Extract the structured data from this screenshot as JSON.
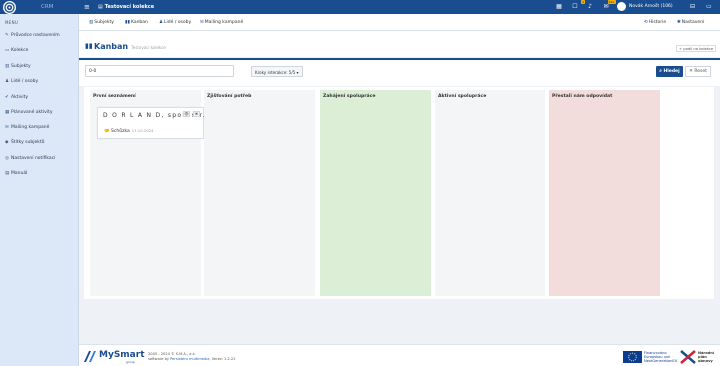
{
  "app": {
    "name": "CRM"
  },
  "topbar": {
    "title": "Testovací kolekce",
    "notify_badges": [
      "4",
      "99+"
    ],
    "user_name": "Novák Arnošt (106)"
  },
  "sidebar": {
    "heading": "MENU",
    "items": [
      {
        "label": "Průvodce nastavením",
        "icon": "wand-icon"
      },
      {
        "label": "Kolekce",
        "icon": "folder-icon"
      },
      {
        "label": "Subjekty",
        "icon": "building-icon"
      },
      {
        "label": "Lidé / osoby",
        "icon": "person-icon"
      },
      {
        "label": "Aktivity",
        "icon": "check-icon"
      },
      {
        "label": "Plánované aktivity",
        "icon": "calendar-icon"
      },
      {
        "label": "Mailing kampaně",
        "icon": "mail-icon"
      },
      {
        "label": "Štítky subjektů",
        "icon": "tag-icon"
      },
      {
        "label": "Nastavení notifikací",
        "icon": "bell-icon"
      },
      {
        "label": "Manuál",
        "icon": "book-icon"
      }
    ]
  },
  "subnav": {
    "tabs": [
      "Subjekty",
      "Kanban",
      "Lidé / osoby",
      "Mailing kampaně"
    ],
    "history": "Historie",
    "settings": "Nastavení"
  },
  "page": {
    "title": "Kanban",
    "subtitle": "Testovací kolekce",
    "add_button": "+ podíl na kolekce"
  },
  "filters": {
    "search_value": "0-0",
    "select_value": "Kroky interakce: 5/5",
    "search_button": "Hledej",
    "reset_button": "Reset"
  },
  "kanban": {
    "columns": [
      {
        "title": "První seznámení",
        "color": "#f4f5f7"
      },
      {
        "title": "Zjišťování potřeb",
        "color": "#f4f5f7"
      },
      {
        "title": "Zahájení spolupráce",
        "color": "#dcefd6"
      },
      {
        "title": "Aktivní spolupráce",
        "color": "#f4f5f7"
      },
      {
        "title": "Přestali nám odpovídat",
        "color": "#f3dcdc"
      },
      {
        "title": "",
        "color": "#ffffff"
      }
    ],
    "card": {
      "company": "D O R L A N D, spol. s r.o.",
      "event_label": "Schůzka",
      "event_date": "17.10.2024"
    }
  },
  "footer": {
    "brand": "MySmart",
    "brand_sub": "group",
    "copyright": "2005 - 2024 © S.M.A., a.s.",
    "powered_prefix": "software by",
    "powered_link": "Persistent multimedia",
    "version": ", Verze: 1.2.22",
    "eu_line1": "Financováno",
    "eu_line2": "Evropskou unií",
    "eu_line3": "NextGenerationEU",
    "npo_line1": "Národní",
    "npo_line2": "plán",
    "npo_line3": "obnovy"
  },
  "colors": {
    "primary": "#1a4d8f",
    "green_column": "#dcefd6",
    "red_column": "#f3dcdc"
  }
}
